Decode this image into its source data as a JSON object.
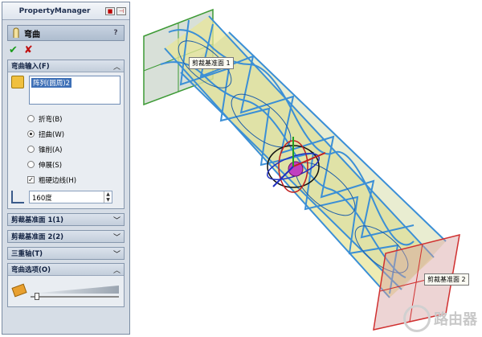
{
  "panel": {
    "title": "PropertyManager",
    "feature_name": "弯曲",
    "help_glyph": "?",
    "ok_glyph": "✔",
    "cancel_glyph": "✘",
    "bend_input": {
      "header": "弯曲输入(F)",
      "selection": "阵列(圆周)2",
      "options": [
        {
          "label": "折弯(B)",
          "selected": false
        },
        {
          "label": "扭曲(W)",
          "selected": true
        },
        {
          "label": "锥削(A)",
          "selected": false
        },
        {
          "label": "伸展(S)",
          "selected": false
        }
      ],
      "rigid_edges_label": "粗硬边线(H)",
      "rigid_edges_checked": true,
      "angle_value": "160度"
    },
    "collapsed_sections": [
      {
        "label": "剪裁基准面 1(1)"
      },
      {
        "label": "剪裁基准面 2(2)"
      },
      {
        "label": "三重轴(T)"
      }
    ],
    "bend_options": {
      "header": "弯曲选项(O)",
      "accuracy": 0.05
    }
  },
  "view": {
    "plane_label_1": "剪裁基准面 1",
    "plane_label_2": "剪裁基准面 2"
  },
  "watermark": "路由器",
  "colors": {
    "plane1": "#4aa040",
    "plane2": "#d03030",
    "lattice": "#3b8fd6",
    "fill": "#e8e59a"
  }
}
